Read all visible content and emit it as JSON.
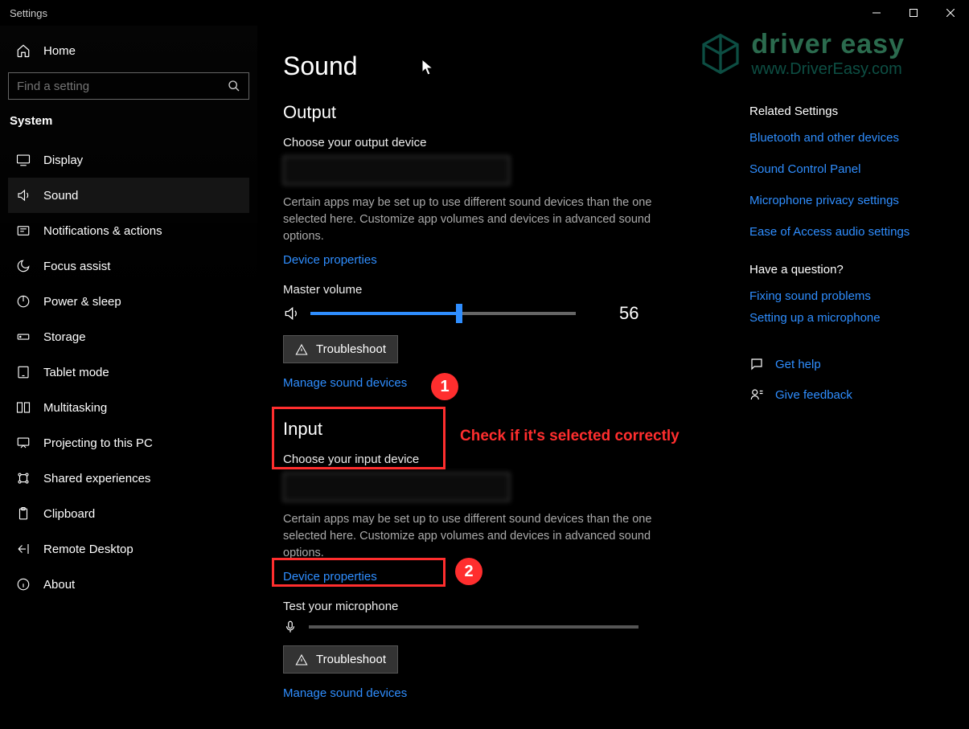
{
  "window": {
    "title": "Settings"
  },
  "sidebar": {
    "home": "Home",
    "search_placeholder": "Find a setting",
    "category": "System",
    "items": [
      {
        "label": "Display"
      },
      {
        "label": "Sound"
      },
      {
        "label": "Notifications & actions"
      },
      {
        "label": "Focus assist"
      },
      {
        "label": "Power & sleep"
      },
      {
        "label": "Storage"
      },
      {
        "label": "Tablet mode"
      },
      {
        "label": "Multitasking"
      },
      {
        "label": "Projecting to this PC"
      },
      {
        "label": "Shared experiences"
      },
      {
        "label": "Clipboard"
      },
      {
        "label": "Remote Desktop"
      },
      {
        "label": "About"
      }
    ]
  },
  "main": {
    "title": "Sound",
    "output": {
      "heading": "Output",
      "choose_label": "Choose your output device",
      "desc": "Certain apps may be set up to use different sound devices than the one selected here. Customize app volumes and devices in advanced sound options.",
      "device_props": "Device properties",
      "master_volume_label": "Master volume",
      "volume_value": "56",
      "volume_percent": 56,
      "troubleshoot": "Troubleshoot",
      "manage": "Manage sound devices"
    },
    "input": {
      "heading": "Input",
      "choose_label": "Choose your input device",
      "desc": "Certain apps may be set up to use different sound devices than the one selected here. Customize app volumes and devices in advanced sound options.",
      "device_props": "Device properties",
      "test_label": "Test your microphone",
      "troubleshoot": "Troubleshoot",
      "manage": "Manage sound devices"
    }
  },
  "side": {
    "related_heading": "Related Settings",
    "links": [
      "Bluetooth and other devices",
      "Sound Control Panel",
      "Microphone privacy settings",
      "Ease of Access audio settings"
    ],
    "question_heading": "Have a question?",
    "qlinks": [
      "Fixing sound problems",
      "Setting up a microphone"
    ],
    "help": "Get help",
    "feedback": "Give feedback"
  },
  "annotations": {
    "text": "Check if it's selected correctly",
    "badge1": "1",
    "badge2": "2"
  },
  "watermark": {
    "brand": "driver easy",
    "url": "www.DriverEasy.com"
  }
}
